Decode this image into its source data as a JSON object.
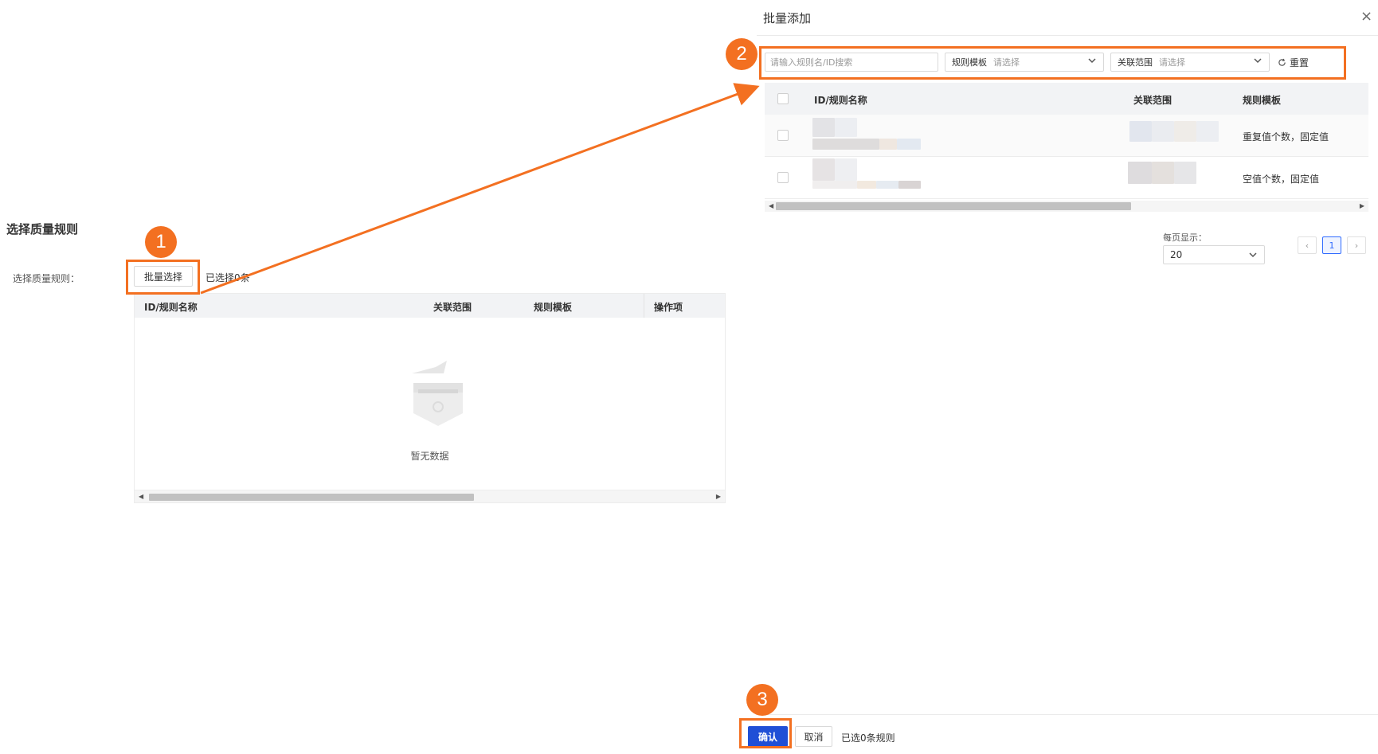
{
  "left": {
    "section_title": "选择质量规则",
    "form_label": "选择质量规则：",
    "batch_button": "批量选择",
    "selected_text": "已选择0条",
    "table": {
      "columns": [
        "ID/规则名称",
        "关联范围",
        "规则模板",
        "操作项"
      ],
      "empty_text": "暂无数据"
    }
  },
  "drawer": {
    "title": "批量添加",
    "close_icon": "close-icon",
    "search": {
      "placeholder": "请输入规则名/ID搜索",
      "value": ""
    },
    "template_filter": {
      "label": "规则模板",
      "placeholder": "请选择"
    },
    "scope_filter": {
      "label": "关联范围",
      "placeholder": "请选择"
    },
    "reset_label": "重置",
    "table": {
      "columns": [
        "ID/规则名称",
        "关联范围",
        "规则模板"
      ],
      "rows": [
        {
          "template": "重复值个数，固定值"
        },
        {
          "template": "空值个数，固定值"
        }
      ]
    },
    "page_size_label": "每页显示：",
    "page_size_value": "20",
    "current_page": "1",
    "confirm_label": "确认",
    "cancel_label": "取消",
    "footer_count": "已选0条规则"
  },
  "annotations": {
    "badge_1": "1",
    "badge_2": "2",
    "badge_3": "3",
    "color": "#f37021"
  }
}
